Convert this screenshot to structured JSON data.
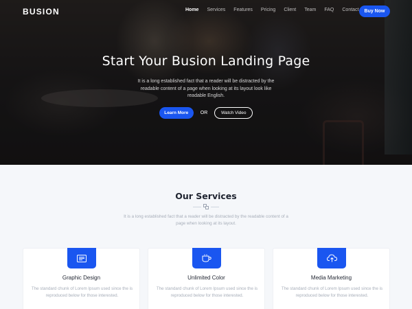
{
  "brand": "BUSION",
  "nav": {
    "items": [
      "Home",
      "Services",
      "Features",
      "Pricing",
      "Client",
      "Team",
      "FAQ",
      "Contact"
    ],
    "active_index": 0,
    "cta_label": "Buy Now"
  },
  "hero": {
    "title": "Start Your Busion Landing Page",
    "description": "It is a long established fact that a reader will be distracted by the readable content of a page when looking at its layout look like readable English.",
    "primary_label": "Learn More",
    "or_label": "OR",
    "secondary_label": "Watch Video"
  },
  "services": {
    "title": "Our Services",
    "description": "It is a long established fact that a reader will be distracted by the readable content of a page when looking at its layout.",
    "cards": [
      {
        "icon": "graphic-design-icon",
        "title": "Graphic Design",
        "description": "The standard chunk of Lorem Ipsum used since the is reproduced below for those interested."
      },
      {
        "icon": "coffee-cup-icon",
        "title": "Unlimited Color",
        "description": "The standard chunk of Lorem Ipsum used since the is reproduced below for those interested."
      },
      {
        "icon": "cloud-upload-icon",
        "title": "Media Marketing",
        "description": "The standard chunk of Lorem Ipsum used since the is reproduced below for those interested."
      }
    ]
  },
  "colors": {
    "accent": "#1a56f0",
    "heading": "#1f2430",
    "muted_text": "#a7aeb9",
    "section_bg": "#f5f7fa"
  }
}
